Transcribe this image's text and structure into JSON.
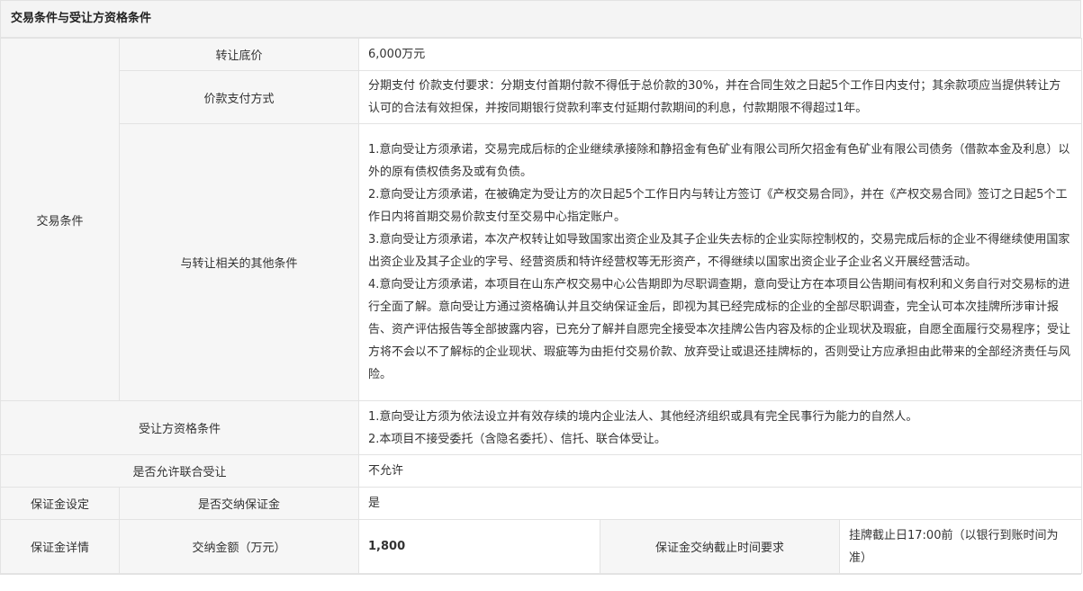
{
  "section_title": "交易条件与受让方资格条件",
  "transaction": {
    "group_label": "交易条件",
    "base_price": {
      "label": "转让底价",
      "value": "6,000万元"
    },
    "payment": {
      "label": "价款支付方式",
      "value": "分期支付 价款支付要求：分期支付首期付款不得低于总价款的30%，并在合同生效之日起5个工作日内支付；其余款项应当提供转让方认可的合法有效担保，并按同期银行贷款利率支付延期付款期间的利息，付款期限不得超过1年。"
    },
    "other_conditions": {
      "label": "与转让相关的其他条件",
      "items": [
        "1.意向受让方须承诺，交易完成后标的企业继续承接除和静招金有色矿业有限公司所欠招金有色矿业有限公司债务（借款本金及利息）以外的原有债权债务及或有负债。",
        "2.意向受让方须承诺，在被确定为受让方的次日起5个工作日内与转让方签订《产权交易合同》，并在《产权交易合同》签订之日起5个工作日内将首期交易价款支付至交易中心指定账户。",
        "3.意向受让方须承诺，本次产权转让如导致国家出资企业及其子企业失去标的企业实际控制权的，交易完成后标的企业不得继续使用国家出资企业及其子企业的字号、经营资质和特许经营权等无形资产，不得继续以国家出资企业子企业名义开展经营活动。",
        "4.意向受让方须承诺，本项目在山东产权交易中心公告期即为尽职调查期，意向受让方在本项目公告期间有权利和义务自行对交易标的进行全面了解。意向受让方通过资格确认并且交纳保证金后，即视为其已经完成标的企业的全部尽职调查，完全认可本次挂牌所涉审计报告、资产评估报告等全部披露内容，已充分了解并自愿完全接受本次挂牌公告内容及标的企业现状及瑕疵，自愿全面履行交易程序；受让方将不会以不了解标的企业现状、瑕疵等为由拒付交易价款、放弃受让或退还挂牌标的，否则受让方应承担由此带来的全部经济责任与风险。"
      ]
    }
  },
  "qualification": {
    "label": "受让方资格条件",
    "items": [
      "1.意向受让方须为依法设立并有效存续的境内企业法人、其他经济组织或具有完全民事行为能力的自然人。",
      "2.本项目不接受委托（含隐名委托）、信托、联合体受让。"
    ]
  },
  "joint": {
    "label": "是否允许联合受让",
    "value": "不允许"
  },
  "deposit_setting": {
    "group_label": "保证金设定",
    "label": "是否交纳保证金",
    "value": "是"
  },
  "deposit_detail": {
    "group_label": "保证金详情",
    "amount_label": "交纳金额（万元）",
    "amount_value": "1,800",
    "deadline_label": "保证金交纳截止时间要求",
    "deadline_value": "挂牌截止日17:00前（以银行到账时间为准）"
  }
}
